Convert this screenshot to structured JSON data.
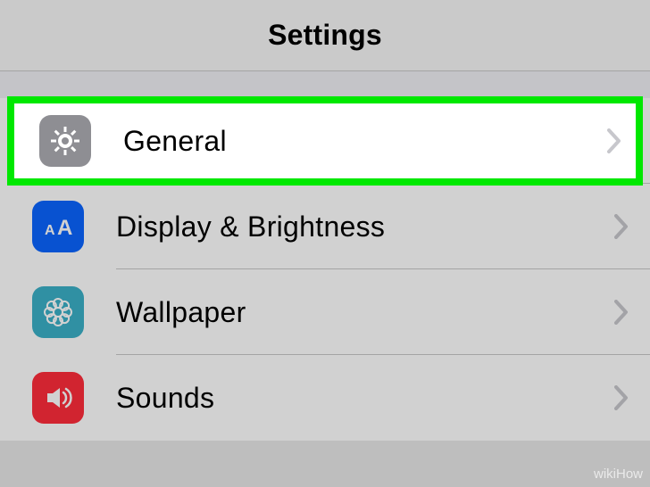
{
  "header": {
    "title": "Settings"
  },
  "rows": {
    "general": {
      "label": "General"
    },
    "display": {
      "label": "Display & Brightness"
    },
    "wallpaper": {
      "label": "Wallpaper"
    },
    "sounds": {
      "label": "Sounds"
    }
  },
  "watermark": "wikiHow"
}
